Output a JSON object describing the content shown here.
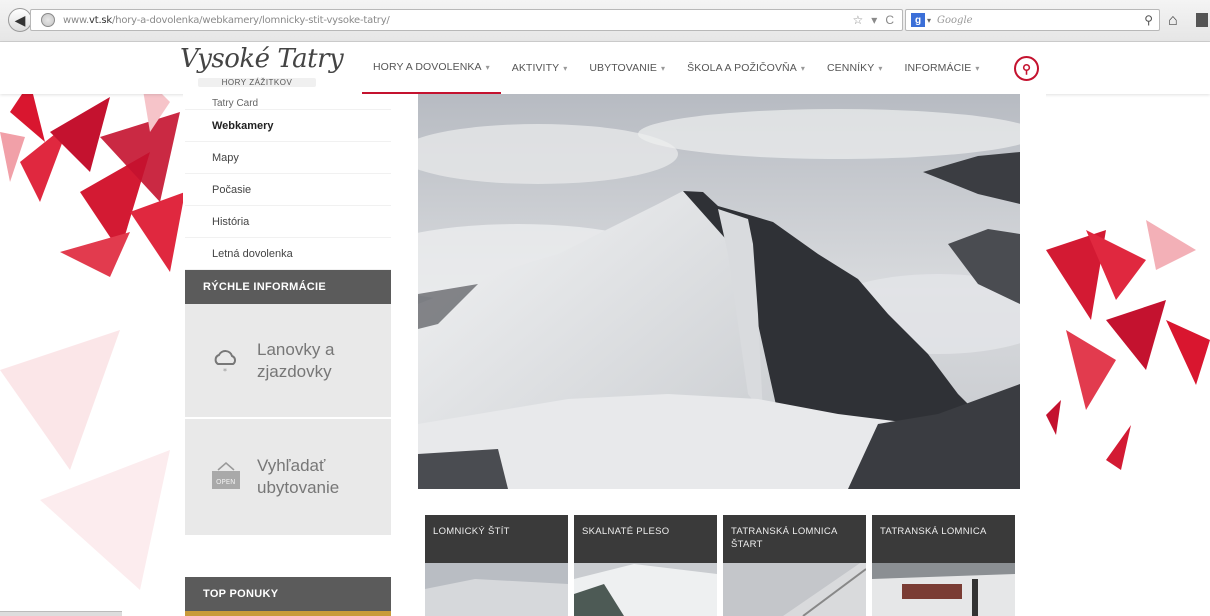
{
  "browser": {
    "url_prefix": "www.",
    "url_domain": "vt.sk",
    "url_path": "/hory-a-dovolenka/webkamery/lomnicky-stit-vysoke-tatry/",
    "search_placeholder": "Google",
    "search_provider_letter": "g"
  },
  "site": {
    "logo_title": "Vysoké Tatry",
    "logo_subtitle": "HORY ZÁŽITKOV",
    "nav": [
      {
        "label": "HORY A DOVOLENKA"
      },
      {
        "label": "AKTIVITY"
      },
      {
        "label": "UBYTOVANIE"
      },
      {
        "label": "ŠKOLA A POŽIČOVŇA"
      },
      {
        "label": "CENNÍKY"
      },
      {
        "label": "INFORMÁCIE"
      }
    ]
  },
  "sidebar": {
    "items": [
      {
        "label": "Tatry Card"
      },
      {
        "label": "Webkamery"
      },
      {
        "label": "Mapy"
      },
      {
        "label": "Počasie"
      },
      {
        "label": "História"
      },
      {
        "label": "Letná dovolenka"
      }
    ],
    "quick_title": "RÝCHLE INFORMÁCIE",
    "quick": [
      {
        "line1": "Lanovky a",
        "line2": "zjazdovky",
        "icon": "cloud-snow-icon"
      },
      {
        "line1": "Vyhľadať",
        "line2": "ubytovanie",
        "icon": "open-sign-icon",
        "badge": "OPEN"
      }
    ],
    "top_title": "TOP PONUKY"
  },
  "thumbs": [
    {
      "line1": "LOMNICKÝ ŠTÍT",
      "line2": ""
    },
    {
      "line1": "SKALNATÉ PLESO",
      "line2": ""
    },
    {
      "line1": "TATRANSKÁ LOMNICA",
      "line2": "ŠTART"
    },
    {
      "line1": "TATRANSKÁ LOMNICA",
      "line2": ""
    }
  ],
  "colors": {
    "accent": "#c4122f",
    "sidebar_title": "#5b5b5b",
    "quick_box": "#e9e9e9"
  }
}
